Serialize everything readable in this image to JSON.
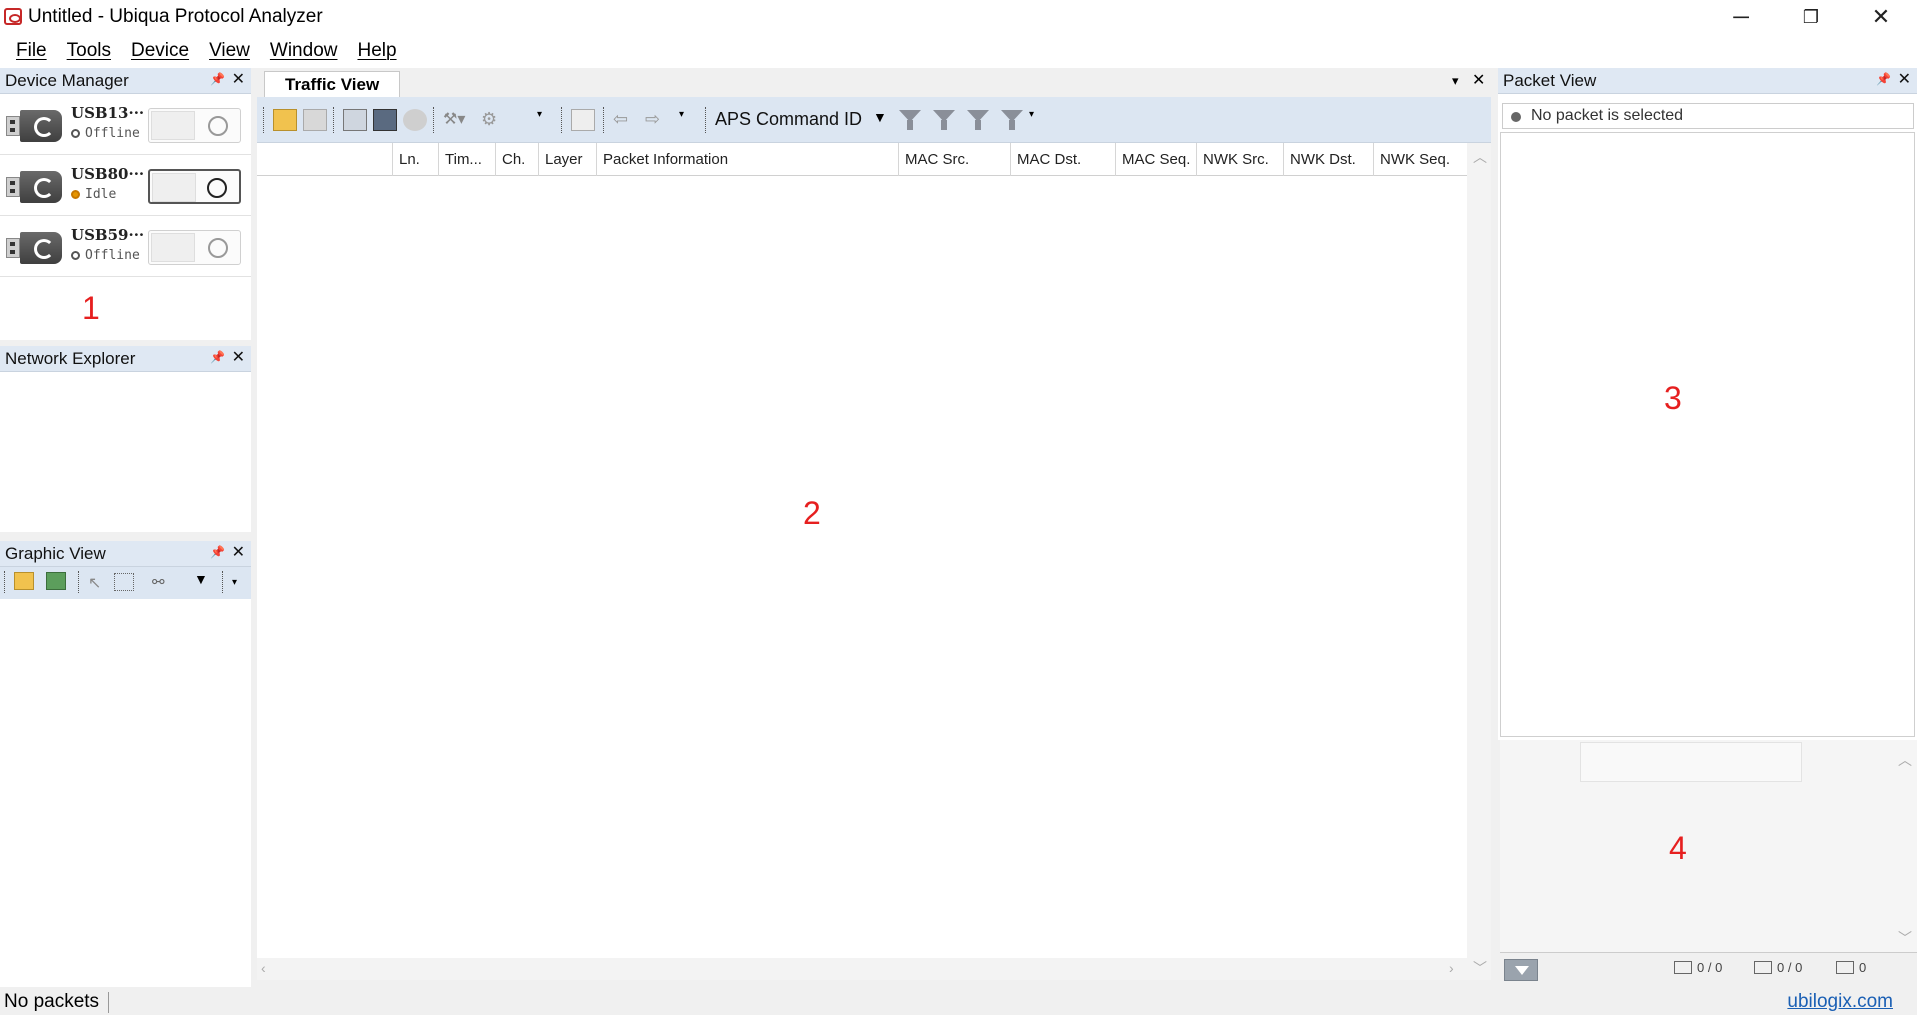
{
  "window": {
    "title": "Untitled - Ubiqua Protocol Analyzer",
    "controls": {
      "minimize": "─",
      "restore": "❐",
      "close": "✕"
    }
  },
  "menu": [
    "File",
    "Tools",
    "Device",
    "View",
    "Window",
    "Help"
  ],
  "device_manager": {
    "title": "Device Manager",
    "devices": [
      {
        "name": "USB13···",
        "status": "Offline",
        "state": "offline"
      },
      {
        "name": "USB80···",
        "status": "Idle",
        "state": "idle"
      },
      {
        "name": "USB59···",
        "status": "Offline",
        "state": "offline"
      }
    ]
  },
  "network_explorer": {
    "title": "Network Explorer"
  },
  "graphic_view": {
    "title": "Graphic View"
  },
  "traffic_view": {
    "tab": "Traffic View",
    "filter_select": "APS Command ID",
    "columns": [
      "Ln.",
      "Tim...",
      "Ch.",
      "Layer",
      "Packet Information",
      "MAC Src.",
      "MAC Dst.",
      "MAC Seq.",
      "NWK Src.",
      "NWK Dst.",
      "NWK Seq."
    ]
  },
  "packet_view": {
    "title": "Packet View",
    "message": "No packet is selected",
    "counters": [
      "0 / 0",
      "0 / 0",
      "0"
    ]
  },
  "annotations": [
    "1",
    "2",
    "3",
    "4"
  ],
  "status_bar": {
    "text": "No packets",
    "link": "ubilogix.com"
  },
  "colors": {
    "panel_header": "#dfe8f3",
    "annotation": "#e61f1f",
    "link": "#1a5fb4",
    "idle_dot": "#e69500"
  }
}
